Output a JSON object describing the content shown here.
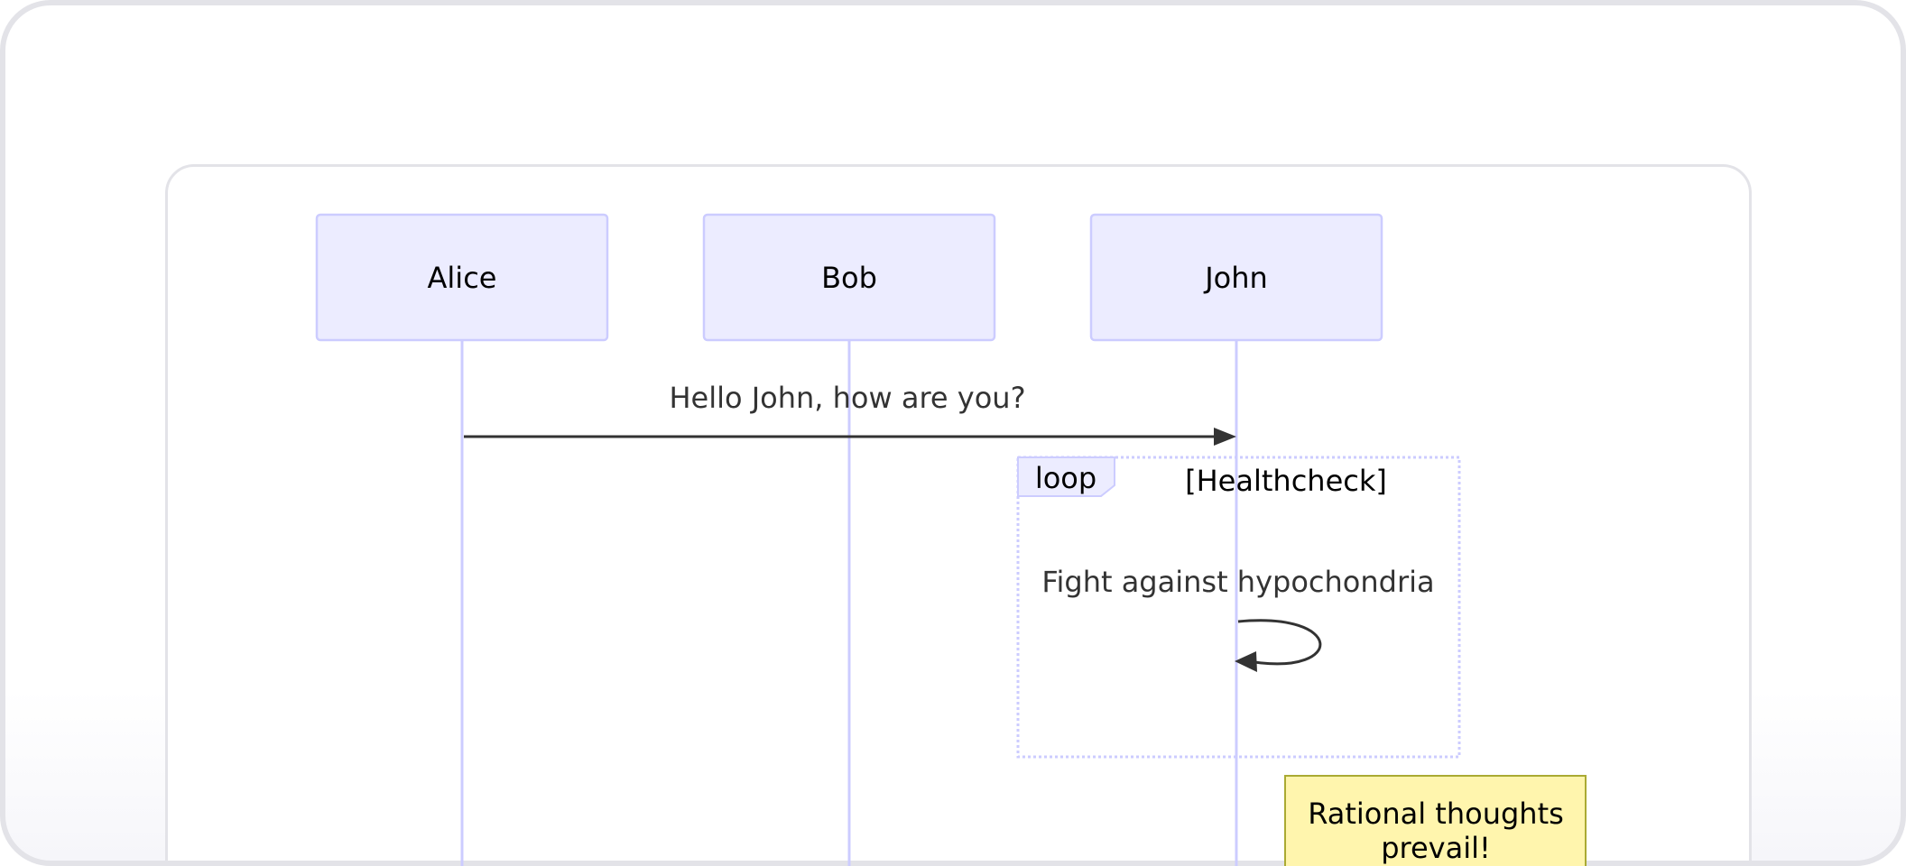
{
  "diagram": {
    "actors": [
      {
        "id": "alice",
        "label": "Alice"
      },
      {
        "id": "bob",
        "label": "Bob"
      },
      {
        "id": "john",
        "label": "John"
      }
    ],
    "messages": [
      {
        "from": "Alice",
        "to": "John",
        "label": "Hello John, how are you?"
      }
    ],
    "loop": {
      "keyword": "loop",
      "condition": "[Healthcheck]",
      "self_message": {
        "actor": "John",
        "label": "Fight against hypochondria"
      }
    },
    "note": {
      "position": "right of John",
      "lines": [
        "Rational thoughts",
        "prevail!"
      ]
    },
    "colors": {
      "actor_fill": "#ececff",
      "actor_stroke": "#ccccff",
      "lifeline": "#ccccff",
      "arrow": "#333333",
      "note_fill": "#fff5ad",
      "note_stroke": "#aaaa33",
      "loop_border": "#ccccff",
      "frame_border": "#e3e3e8"
    }
  }
}
